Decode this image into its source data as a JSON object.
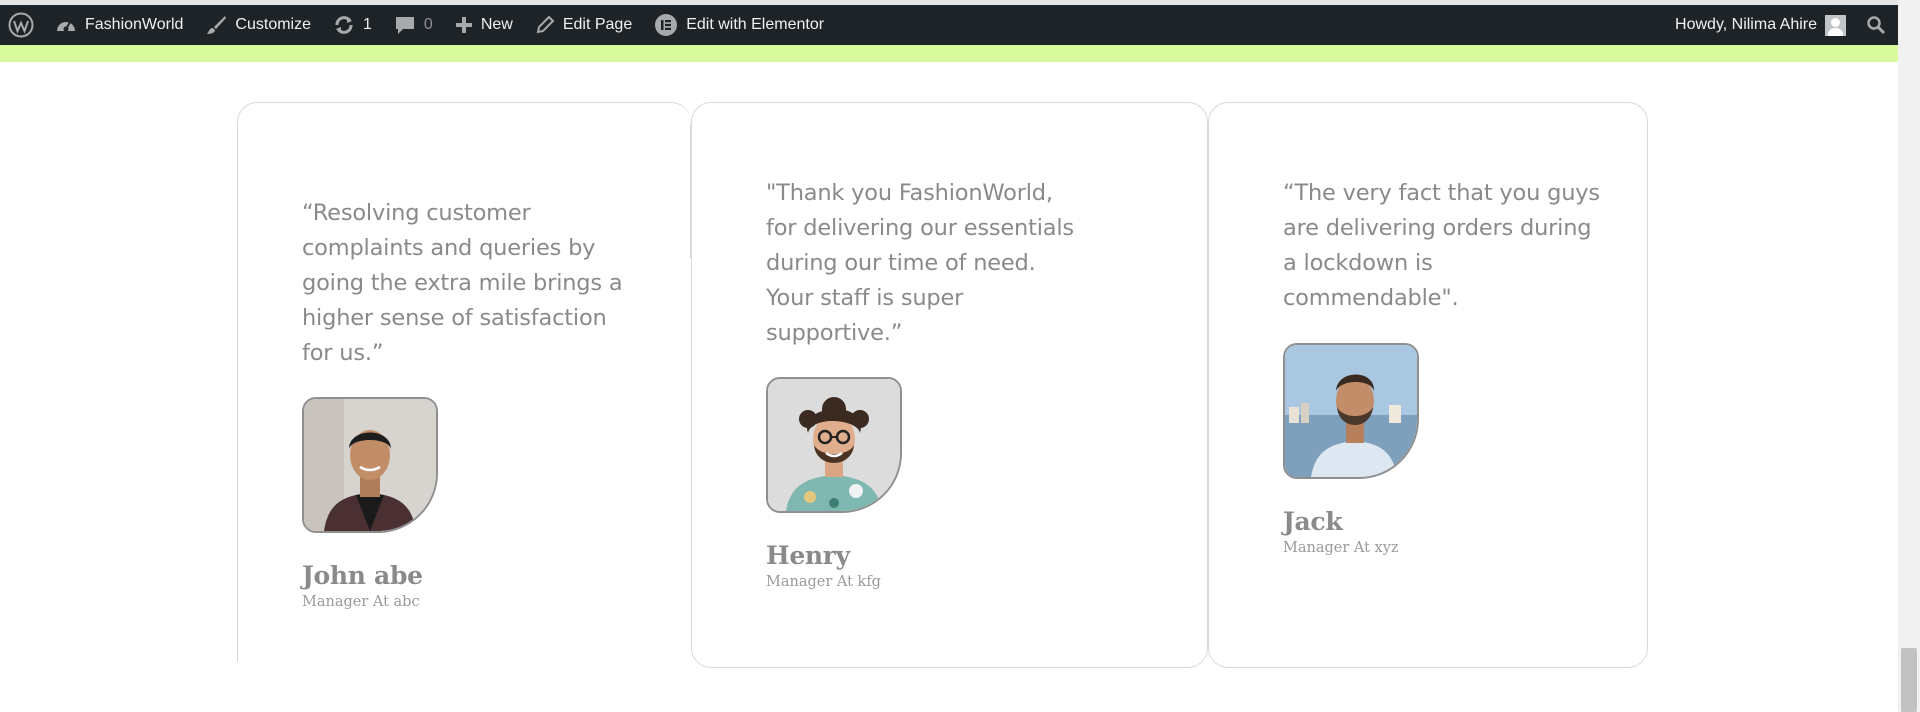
{
  "adminbar": {
    "site_name": "FashionWorld",
    "customize": "Customize",
    "updates_count": "1",
    "comments_count": "0",
    "new": "New",
    "edit_page": "Edit Page",
    "edit_elementor": "Edit with Elementor",
    "howdy": "Howdy, Nilima Ahire"
  },
  "colors": {
    "adminbar_bg": "#1d2327",
    "accent_band": "#d9f99d",
    "card_border": "#d9d9d9",
    "text_gray": "#8a8a8a"
  },
  "testimonials": [
    {
      "quote": "“Resolving customer complaints and queries by going the extra mile brings a higher sense of satisfaction for us.”",
      "name": "John abe",
      "role": "Manager At abc"
    },
    {
      "quote": "\"Thank you FashionWorld, for delivering our essentials during our time of need. Your staff is super supportive.”",
      "name": "Henry",
      "role": "Manager At kfg"
    },
    {
      "quote": "“The very fact that you guys are delivering orders during a lockdown is commendable\".",
      "name": "Jack",
      "role": "Manager At xyz"
    }
  ]
}
